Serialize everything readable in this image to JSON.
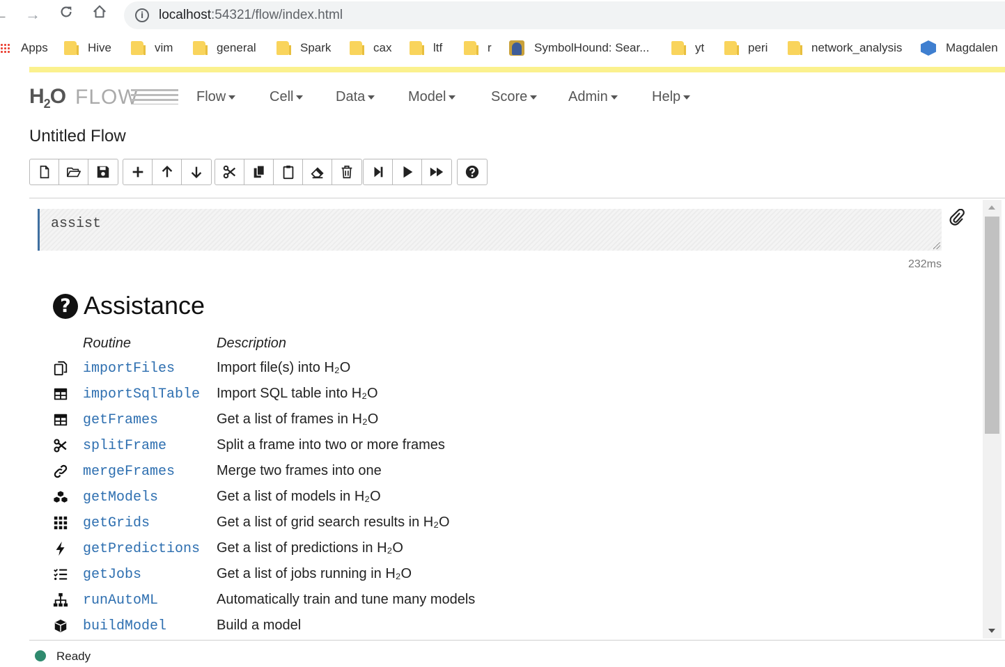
{
  "browser": {
    "url_host": "localhost",
    "url_path": ":54321/flow/index.html",
    "bookmarks": [
      {
        "label": "Apps"
      },
      {
        "label": "Hive"
      },
      {
        "label": "vim"
      },
      {
        "label": "general"
      },
      {
        "label": "Spark"
      },
      {
        "label": "cax"
      },
      {
        "label": "ltf"
      },
      {
        "label": "r"
      },
      {
        "label": "SymbolHound: Sear..."
      },
      {
        "label": "yt"
      },
      {
        "label": "peri"
      },
      {
        "label": "network_analysis"
      },
      {
        "label": "Magdalen"
      }
    ]
  },
  "navbar": {
    "logo_h2o": "H",
    "logo_sub": "2",
    "logo_o": "O",
    "logo_flow": "FLOW",
    "menus": [
      "Flow",
      "Cell",
      "Data",
      "Model",
      "Score",
      "Admin",
      "Help"
    ]
  },
  "flow": {
    "title": "Untitled Flow"
  },
  "cell": {
    "code": "assist",
    "timing": "232ms"
  },
  "assistance": {
    "title": "Assistance",
    "col_routine": "Routine",
    "col_description": "Description",
    "rows": [
      {
        "fn": "importFiles",
        "desc": "Import file(s) into H₂O",
        "icon": "files-icon"
      },
      {
        "fn": "importSqlTable",
        "desc": "Import SQL table into H₂O",
        "icon": "table-icon"
      },
      {
        "fn": "getFrames",
        "desc": "Get a list of frames in H₂O",
        "icon": "table-icon"
      },
      {
        "fn": "splitFrame",
        "desc": "Split a frame into two or more frames",
        "icon": "scissors-icon"
      },
      {
        "fn": "mergeFrames",
        "desc": "Merge two frames into one",
        "icon": "link-icon"
      },
      {
        "fn": "getModels",
        "desc": "Get a list of models in H₂O",
        "icon": "cubes-icon"
      },
      {
        "fn": "getGrids",
        "desc": "Get a list of grid search results in H₂O",
        "icon": "grid-icon"
      },
      {
        "fn": "getPredictions",
        "desc": "Get a list of predictions in H₂O",
        "icon": "bolt-icon"
      },
      {
        "fn": "getJobs",
        "desc": "Get a list of jobs running in H₂O",
        "icon": "tasks-icon"
      },
      {
        "fn": "runAutoML",
        "desc": "Automatically train and tune many models",
        "icon": "sitemap-icon"
      },
      {
        "fn": "buildModel",
        "desc": "Build a model",
        "icon": "cube-icon"
      }
    ]
  },
  "status": {
    "text": "Ready",
    "color": "#2f8a6e"
  }
}
